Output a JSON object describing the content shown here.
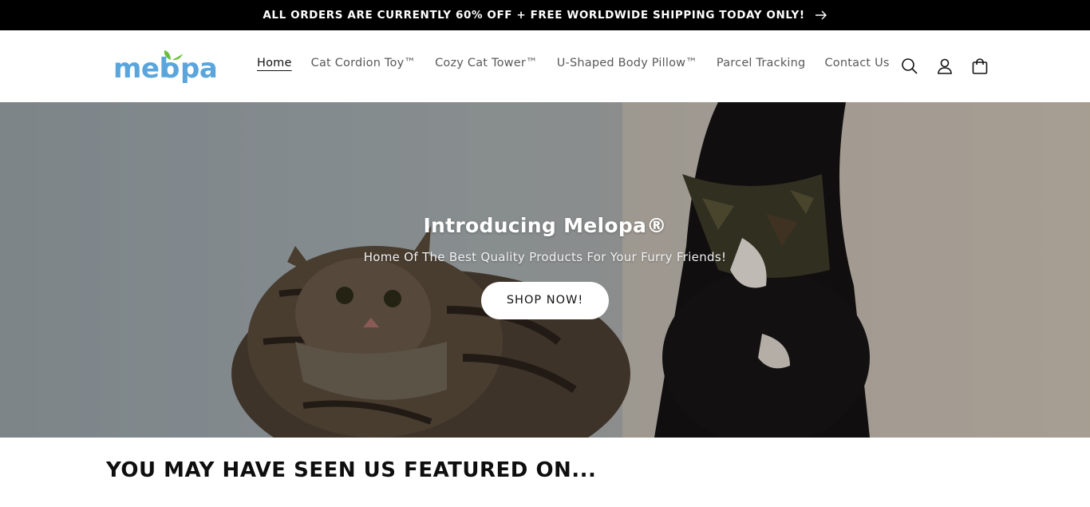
{
  "announcement": {
    "text": "ALL ORDERS ARE CURRENTLY 60% OFF + FREE WORLDWIDE SHIPPING TODAY ONLY!",
    "icon": "arrow-right-icon"
  },
  "header": {
    "logo_text": "melopa",
    "nav": [
      {
        "label": "Home",
        "active": true
      },
      {
        "label": "Cat Cordion Toy™",
        "active": false
      },
      {
        "label": "Cozy Cat Tower™",
        "active": false
      },
      {
        "label": "U-Shaped Body Pillow™",
        "active": false
      },
      {
        "label": "Parcel Tracking",
        "active": false
      },
      {
        "label": "Contact Us",
        "active": false
      }
    ],
    "icons": [
      "search-icon",
      "account-icon",
      "cart-icon"
    ]
  },
  "hero": {
    "title": "Introducing Melopa®",
    "subtitle": "Home Of The Best Quality Products For Your Furry Friends!",
    "button_label": "SHOP NOW!"
  },
  "featured": {
    "title": "YOU MAY HAVE SEEN US FEATURED ON..."
  },
  "colors": {
    "announcement_bg": "#000000",
    "logo_blue": "#5aa6dc",
    "logo_leaf": "#6cbf3c",
    "nav_text": "#5a5a5a",
    "button_bg": "#ffffff"
  }
}
